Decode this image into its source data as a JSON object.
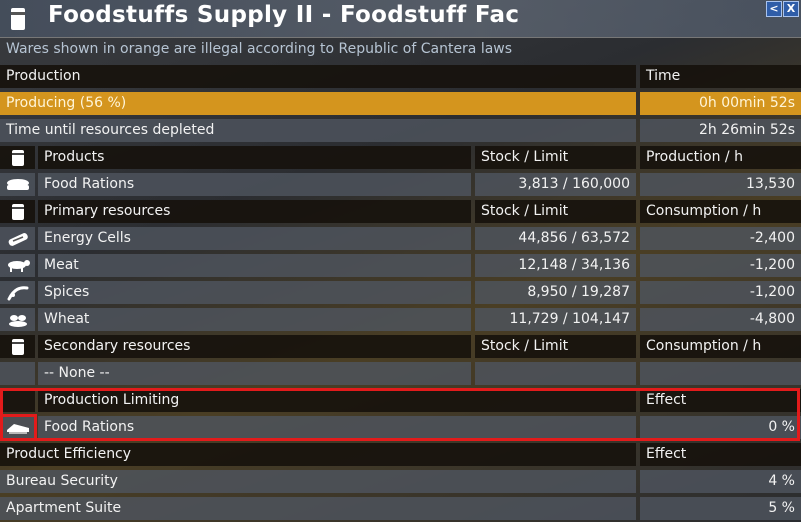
{
  "window": {
    "title": "Foodstuffs Supply II - Foodstuff Fac",
    "back_label": "<",
    "close_label": "X"
  },
  "notice": "Wares shown in orange are illegal according to Republic of Cantera laws",
  "production": {
    "header": "Production",
    "header_time": "Time",
    "status": "Producing (56 %)",
    "status_time": "0h 00min 52s",
    "depletion_label": "Time until resources depleted",
    "depletion_time": "2h 26min 52s"
  },
  "products": {
    "header": "Products",
    "col_stock": "Stock / Limit",
    "col_rate": "Production / h",
    "items": [
      {
        "name": "Food Rations",
        "stock": "3,813 / 160,000",
        "rate": "13,530",
        "icon": "food-rations-icon"
      }
    ]
  },
  "primary": {
    "header": "Primary resources",
    "col_stock": "Stock / Limit",
    "col_rate": "Consumption / h",
    "items": [
      {
        "name": "Energy Cells",
        "stock": "44,856 / 63,572",
        "rate": "-2,400",
        "icon": "energy-cells-icon"
      },
      {
        "name": "Meat",
        "stock": "12,148 / 34,136",
        "rate": "-1,200",
        "icon": "meat-icon"
      },
      {
        "name": "Spices",
        "stock": "8,950 / 19,287",
        "rate": "-1,200",
        "icon": "spices-icon"
      },
      {
        "name": "Wheat",
        "stock": "11,729 / 104,147",
        "rate": "-4,800",
        "icon": "wheat-icon"
      }
    ]
  },
  "secondary": {
    "header": "Secondary resources",
    "col_stock": "Stock / Limit",
    "col_rate": "Consumption / h",
    "none_label": "-- None --"
  },
  "limiting": {
    "header": "Production Limiting",
    "col_effect": "Effect",
    "items": [
      {
        "name": "Food Rations",
        "effect": "0 %",
        "icon": "food-rations-limiting-icon"
      }
    ]
  },
  "efficiency": {
    "header": "Product Efficiency",
    "col_effect": "Effect",
    "items": [
      {
        "name": "Bureau Security",
        "effect": "4 %"
      },
      {
        "name": "Apartment Suite",
        "effect": "5 %"
      }
    ]
  },
  "colors": {
    "accent_orange": "#d4951e",
    "highlight_red": "#e21b1b",
    "window_button_blue": "#2f5da8"
  }
}
